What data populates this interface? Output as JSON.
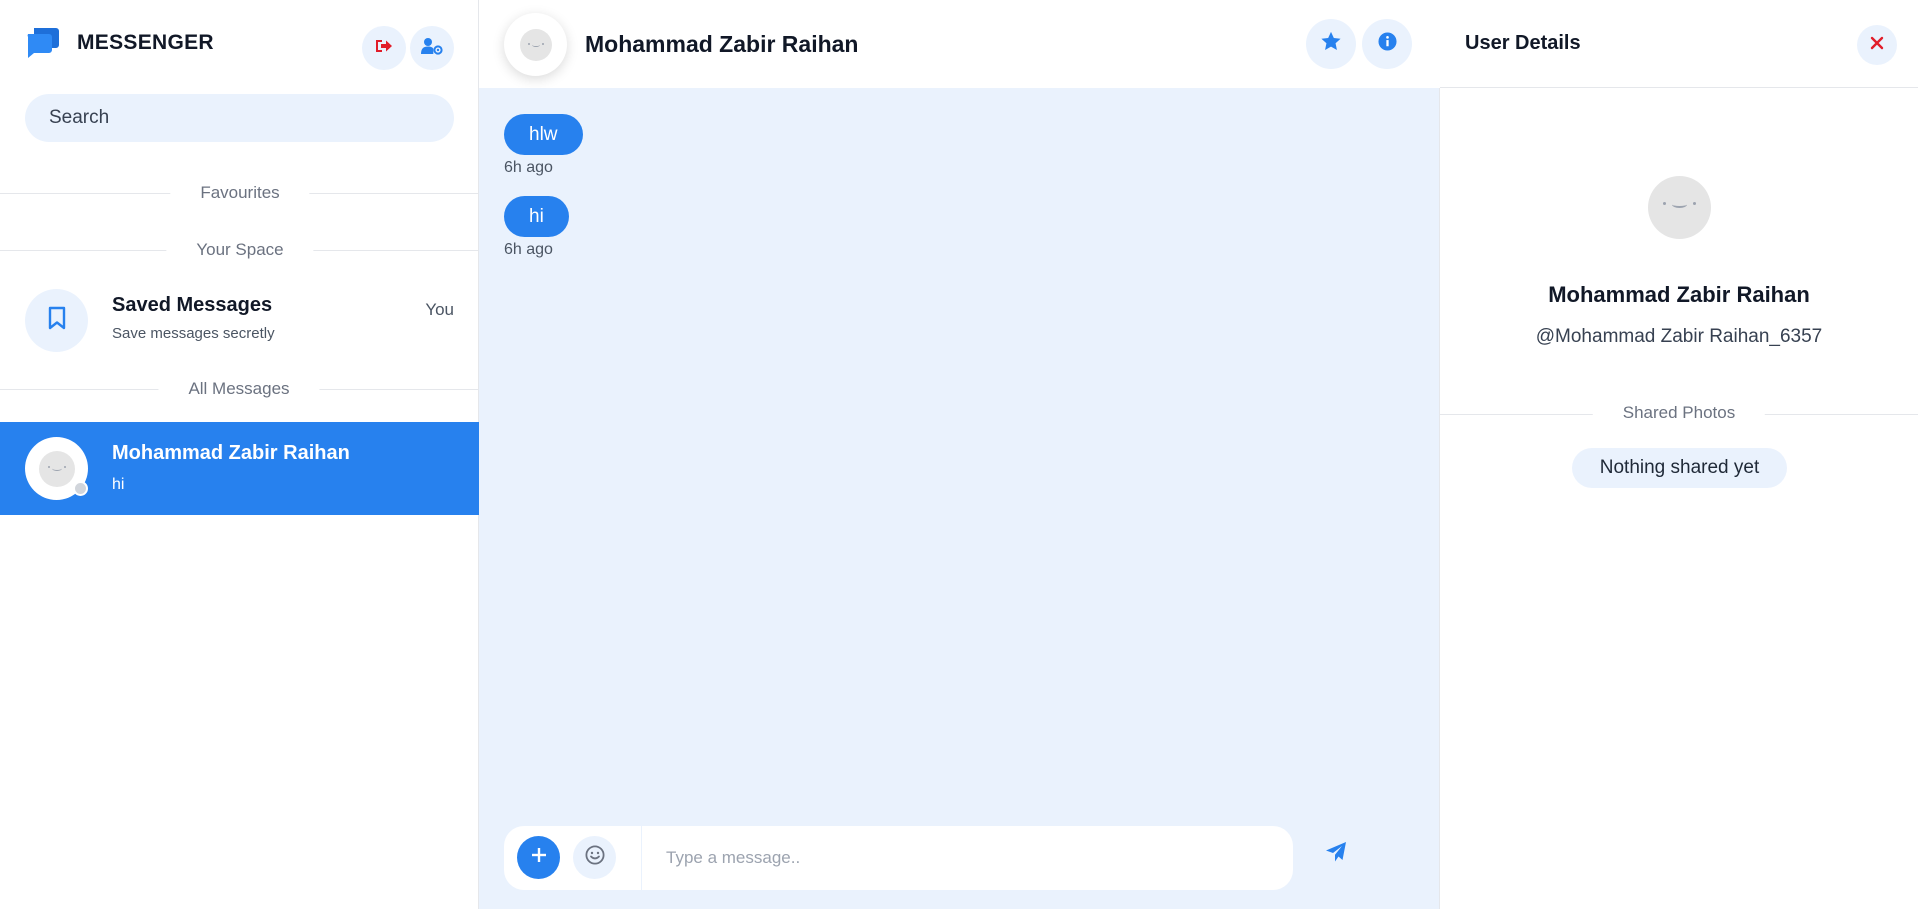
{
  "colors": {
    "accent": "#2781ee",
    "accent_light": "#eaf2fd",
    "danger": "#e11d2a"
  },
  "sidebar": {
    "brand": "MESSENGER",
    "icons": {
      "logo": "chat-bubbles-icon",
      "logout": "sign-out-icon",
      "settings": "user-gear-icon"
    },
    "search": {
      "placeholder": "Search"
    },
    "sections": {
      "favourites": "Favourites",
      "your_space": "Your Space",
      "all_messages": "All Messages"
    },
    "saved": {
      "title": "Saved Messages",
      "subtitle": "Save messages secretly",
      "tag": "You",
      "icon": "bookmark-icon"
    },
    "contacts": [
      {
        "name": "Mohammad Zabir Raihan",
        "last_message": "hi",
        "active": true
      }
    ]
  },
  "chat": {
    "contact_name": "Mohammad Zabir Raihan",
    "icons": {
      "favorite": "star-icon",
      "info": "info-icon",
      "attach": "plus-icon",
      "emoji": "smile-icon",
      "send": "paper-plane-icon"
    },
    "messages": [
      {
        "text": "hlw",
        "time": "6h ago"
      },
      {
        "text": "hi",
        "time": "6h ago"
      }
    ],
    "input": {
      "placeholder": "Type a message.."
    }
  },
  "details": {
    "title": "User Details",
    "close_icon": "close-icon",
    "name": "Mohammad Zabir Raihan",
    "handle": "@Mohammad Zabir Raihan_6357",
    "shared_photos_label": "Shared Photos",
    "shared_empty": "Nothing shared yet"
  }
}
